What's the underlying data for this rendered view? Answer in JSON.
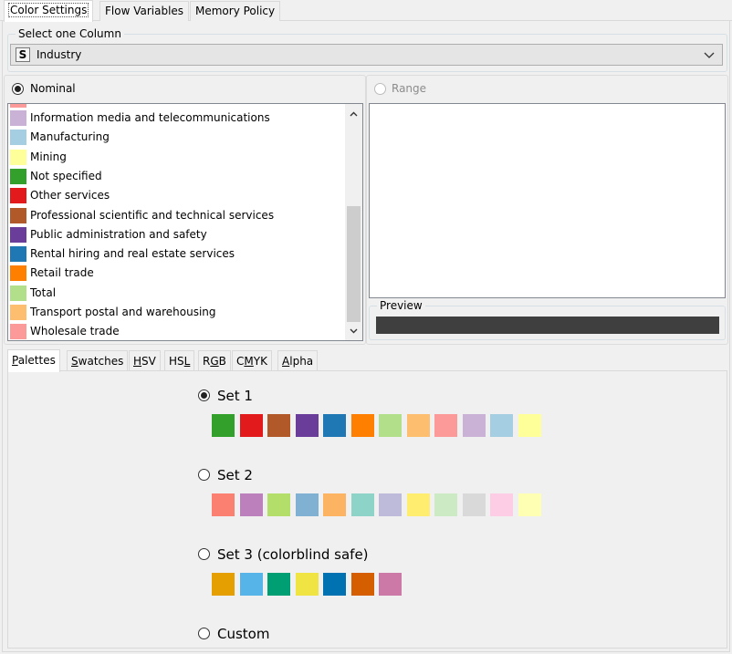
{
  "tabs": [
    {
      "label": "Color Settings",
      "active": true
    },
    {
      "label": "Flow Variables",
      "active": false
    },
    {
      "label": "Memory Policy",
      "active": false
    }
  ],
  "column_select": {
    "legend": "Select one Column",
    "type_badge": "S",
    "value": "Industry"
  },
  "mode": {
    "nominal_label": "Nominal",
    "nominal_selected": true,
    "range_label": "Range",
    "range_enabled": false
  },
  "nominal_list": [
    {
      "label": "Information media and telecommunications",
      "color": "#cab2d6"
    },
    {
      "label": "Manufacturing",
      "color": "#a6cee3"
    },
    {
      "label": "Mining",
      "color": "#ffff99"
    },
    {
      "label": "Not specified",
      "color": "#33a02c"
    },
    {
      "label": "Other services",
      "color": "#e31a1c"
    },
    {
      "label": "Professional scientific and technical services",
      "color": "#b15928"
    },
    {
      "label": "Public administration and safety",
      "color": "#6a3d9a"
    },
    {
      "label": "Rental hiring and real estate services",
      "color": "#1f78b4"
    },
    {
      "label": "Retail trade",
      "color": "#ff7f00"
    },
    {
      "label": "Total",
      "color": "#b2df8a"
    },
    {
      "label": "Transport postal and warehousing",
      "color": "#fdbf6f"
    },
    {
      "label": "Wholesale trade",
      "color": "#fb9a99"
    }
  ],
  "partial_item_color": "#fb9a99",
  "preview": {
    "legend": "Preview",
    "color": "#3f3f3f"
  },
  "color_tabs": [
    {
      "label": "Palettes",
      "underline_index": 0,
      "active": true
    },
    {
      "label": "Swatches",
      "underline_index": 0,
      "active": false
    },
    {
      "label": "HSV",
      "underline_index": 0,
      "active": false
    },
    {
      "label": "HSL",
      "underline_index": 2,
      "active": false
    },
    {
      "label": "RGB",
      "underline_index": 1,
      "active": false
    },
    {
      "label": "CMYK",
      "underline_index": 1,
      "active": false
    },
    {
      "label": "Alpha",
      "underline_index": 0,
      "active": false
    }
  ],
  "palettes": [
    {
      "label": "Set 1",
      "selected": true,
      "colors": [
        "#33a02c",
        "#e31a1c",
        "#b15928",
        "#6a3d9a",
        "#1f78b4",
        "#ff7f00",
        "#b2df8a",
        "#fdbf6f",
        "#fb9a99",
        "#cab2d6",
        "#a6cee3",
        "#ffff99"
      ]
    },
    {
      "label": "Set 2",
      "selected": false,
      "colors": [
        "#fb8072",
        "#bc80bd",
        "#b3de69",
        "#80b1d3",
        "#fdb462",
        "#8dd3c7",
        "#bebada",
        "#ffed6f",
        "#ccebc5",
        "#d9d9d9",
        "#fccde5",
        "#ffffb3"
      ]
    },
    {
      "label": "Set 3 (colorblind safe)",
      "selected": false,
      "colors": [
        "#e69f00",
        "#56b4e9",
        "#009e73",
        "#f0e442",
        "#0072b2",
        "#d55e00",
        "#cc79a7"
      ]
    },
    {
      "label": "Custom",
      "selected": false,
      "colors": []
    }
  ]
}
